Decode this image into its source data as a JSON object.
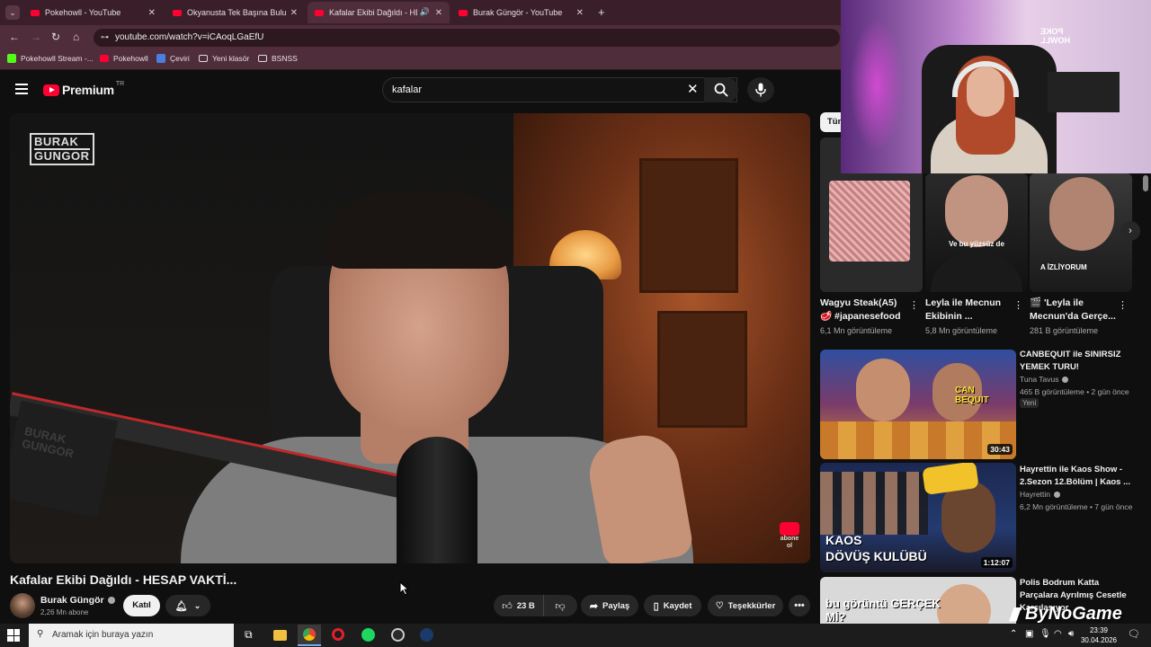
{
  "tabs": [
    {
      "title": "Pokehowll - YouTube",
      "active": false
    },
    {
      "title": "Okyanusta Tek Başına Bulunan",
      "active": false
    },
    {
      "title": "Kafalar Ekibi Dağıldı - HESAP",
      "active": true
    },
    {
      "title": "Burak Güngör - YouTube",
      "active": false
    }
  ],
  "address": {
    "url": "youtube.com/watch?v=iCAoqLGaEfU"
  },
  "bookmarks": [
    {
      "label": "Pokehowll Stream -...",
      "color": "#e8a800"
    },
    {
      "label": "Pokehowll",
      "color": "#ff0033"
    },
    {
      "label": "Çeviri",
      "color": "#4a7fe0"
    },
    {
      "label": "Yeni klasör",
      "color": ""
    },
    {
      "label": "BSNSS",
      "color": ""
    }
  ],
  "header": {
    "logo": "Premium",
    "region": "TR",
    "search_value": "kafalar"
  },
  "video": {
    "watermark_line1": "BURAK",
    "watermark_line2": "GUNGOR",
    "mic_label": "BURAK GUNGOR",
    "subscribe_watermark": "abone ol",
    "title": "Kafalar Ekibi Dağıldı - HESAP VAKTİ..."
  },
  "channel": {
    "name": "Burak Güngör",
    "subscribers": "2,26 Mn abone",
    "join_label": "Katıl"
  },
  "actions": {
    "likes": "23 B",
    "share": "Paylaş",
    "save": "Kaydet",
    "thanks": "Teşekkürler"
  },
  "chips": {
    "first": "Tüm"
  },
  "webcam": {
    "sign_line1": "POKE",
    "sign_line2": "HOWLL"
  },
  "shorts": [
    {
      "title_line1": "Wagyu Steak(A5)",
      "title_line2": "🥩 #japanesefood",
      "views": "6,1 Mn görüntüleme"
    },
    {
      "title_line1": "Leyla ile Mecnun",
      "title_line2": "Ekibinin ...",
      "views": "5,8 Mn görüntüleme",
      "caption": "Ve bu yüzsüz de"
    },
    {
      "title_line1": "🎬 'Leyla ile",
      "title_line2": "Mecnun'da Gerçe...",
      "views": "281 B görüntüleme",
      "caption": "A İZLİYORUM"
    }
  ],
  "recommendations": [
    {
      "title": "CANBEQUIT ile SINIRSIZ YEMEK TURU!",
      "channel": "Tuna Tavus",
      "meta": "465 B görüntüleme • 2 gün önce",
      "badge": "Yeni",
      "duration": "30:43",
      "thumb_text": "CAN BEQUIT"
    },
    {
      "title": "Hayrettin ile Kaos Show - 2.Sezon 12.Bölüm | Kaos ...",
      "channel": "Hayrettin",
      "meta": "6,2 Mn görüntüleme • 7 gün önce",
      "duration": "1:12:07",
      "thumb_text1": "KAOS",
      "thumb_text2": "DÖVÜŞ KULÜBÜ"
    },
    {
      "title": "Polis Bodrum Katta Parçalara Ayrılmış Cesetle Karşılaşıyor",
      "thumb_text": "bu görüntü GERÇEK Mİ?"
    }
  ],
  "overlay": {
    "brand": "ByNoGame"
  },
  "taskbar": {
    "search_placeholder": "Aramak için buraya yazın",
    "time": "23:39",
    "date": "30.04.2026"
  }
}
